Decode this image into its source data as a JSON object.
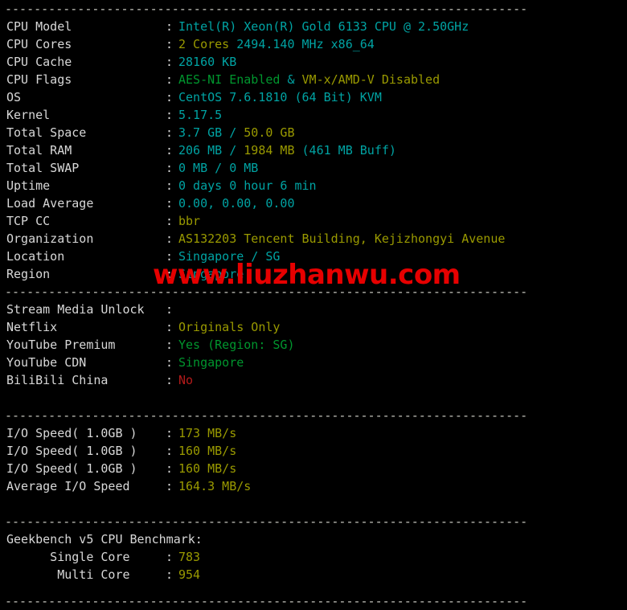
{
  "terminal": {
    "separator": "------------------------------------------------------------------------",
    "separator_full": "--------------------------------------------------------------------------------",
    "watermark": "www.liuzhanwu.com",
    "colon": ":",
    "colors": {
      "background": "#000000",
      "label": "#d8d8d8",
      "cyan": "#00a3a3",
      "yellow": "#9a9a00",
      "green": "#00962e",
      "red": "#b31a1a",
      "watermark": "#e60000"
    }
  },
  "system_info": {
    "cpu_model": {
      "label": "CPU Model",
      "value": "Intel(R) Xeon(R) Gold 6133 CPU @ 2.50GHz"
    },
    "cpu_cores": {
      "label": "CPU Cores",
      "value_cores": "2 Cores",
      "value_rest": " 2494.140 MHz x86_64"
    },
    "cpu_cache": {
      "label": "CPU Cache",
      "value": "28160 KB"
    },
    "cpu_flags": {
      "label": "CPU Flags",
      "value_aes": "AES-NI Enabled",
      "value_amp": " & ",
      "value_vm": "VM-x/AMD-V Disabled"
    },
    "os": {
      "label": "OS",
      "value": "CentOS 7.6.1810 (64 Bit) KVM"
    },
    "kernel": {
      "label": "Kernel",
      "value": "5.17.5"
    },
    "total_space": {
      "label": "Total Space",
      "used": "3.7 GB",
      "sep": " / ",
      "total": "50.0 GB"
    },
    "total_ram": {
      "label": "Total RAM",
      "used": "206 MB",
      "sep": " / ",
      "total": "1984 MB",
      "buff": " (461 MB Buff)"
    },
    "total_swap": {
      "label": "Total SWAP",
      "used": "0 MB",
      "sep": " / ",
      "total": "0 MB"
    },
    "uptime": {
      "label": "Uptime",
      "value": "0 days 0 hour 6 min"
    },
    "load_average": {
      "label": "Load Average",
      "value": "0.00, 0.00, 0.00"
    },
    "tcp_cc": {
      "label": "TCP CC",
      "value": "bbr"
    },
    "organization": {
      "label": "Organization",
      "value": "AS132203 Tencent Building, Kejizhongyi Avenue"
    },
    "location": {
      "label": "Location",
      "value": "Singapore / SG"
    },
    "region": {
      "label": "Region",
      "value": "Singapore"
    }
  },
  "stream_media": {
    "header": {
      "label": "Stream Media Unlock",
      "value": ""
    },
    "netflix": {
      "label": "Netflix",
      "value": "Originals Only"
    },
    "youtube_premium": {
      "label": "YouTube Premium",
      "value": "Yes (Region: SG)"
    },
    "youtube_cdn": {
      "label": "YouTube CDN",
      "value": "Singapore"
    },
    "bilibili_china": {
      "label": "BiliBili China",
      "value": "No"
    }
  },
  "io_speed": {
    "run1": {
      "label": "I/O Speed( 1.0GB )",
      "value": "173 MB/s"
    },
    "run2": {
      "label": "I/O Speed( 1.0GB )",
      "value": "160 MB/s"
    },
    "run3": {
      "label": "I/O Speed( 1.0GB )",
      "value": "160 MB/s"
    },
    "average": {
      "label": "Average I/O Speed",
      "value": "164.3 MB/s"
    }
  },
  "geekbench": {
    "title": "Geekbench v5 CPU Benchmark:",
    "single_core": {
      "label": "      Single Core",
      "value": "783"
    },
    "multi_core": {
      "label": "       Multi Core",
      "value": "954"
    }
  }
}
